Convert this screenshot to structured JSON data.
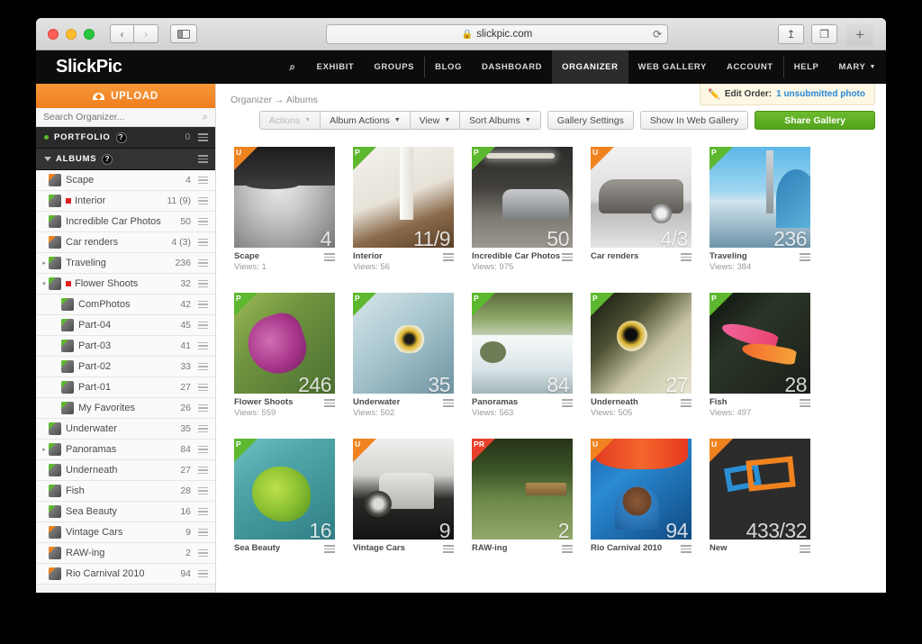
{
  "browser": {
    "url": "slickpic.com",
    "lock_icon": "lock-icon",
    "back_label": "‹",
    "forward_label": "›",
    "reload_label": "⟳",
    "share_label": "↥",
    "tabs_label": "❐",
    "newtab_label": "+"
  },
  "header": {
    "brand": "SlickPic",
    "nav": [
      {
        "label": "",
        "icon": "search-icon",
        "name": "nav-search",
        "active": false,
        "sep": false
      },
      {
        "label": "EXHIBIT",
        "name": "nav-exhibit",
        "active": false,
        "sep": false
      },
      {
        "label": "GROUPS",
        "name": "nav-groups",
        "active": false,
        "sep": false
      },
      {
        "label": "BLOG",
        "name": "nav-blog",
        "active": false,
        "sep": true
      },
      {
        "label": "DASHBOARD",
        "name": "nav-dashboard",
        "active": false,
        "sep": false
      },
      {
        "label": "ORGANIZER",
        "name": "nav-organizer",
        "active": true,
        "sep": false
      },
      {
        "label": "WEB GALLERY",
        "name": "nav-web-gallery",
        "active": false,
        "sep": false
      },
      {
        "label": "ACCOUNT",
        "name": "nav-account",
        "active": false,
        "sep": false
      },
      {
        "label": "HELP",
        "name": "nav-help",
        "active": false,
        "sep": true
      },
      {
        "label": "MARY",
        "name": "nav-user-menu",
        "active": false,
        "sep": false,
        "caret": true
      }
    ]
  },
  "sidebar": {
    "upload_label": "UPLOAD",
    "search_placeholder": "Search Organizer...",
    "portfolio": {
      "label": "PORTFOLIO",
      "help": "?",
      "count": "0"
    },
    "albums_header": {
      "label": "ALBUMS",
      "help": "?"
    },
    "items": [
      {
        "label": "Scape",
        "count": "4",
        "indent": 0,
        "expand": "",
        "corner": "orange",
        "flag": false
      },
      {
        "label": "Interior",
        "count": "11 (9)",
        "indent": 0,
        "expand": "",
        "corner": "green",
        "flag": true
      },
      {
        "label": "Incredible Car Photos",
        "count": "50",
        "indent": 0,
        "expand": "",
        "corner": "green",
        "flag": false
      },
      {
        "label": "Car renders",
        "count": "4 (3)",
        "indent": 0,
        "expand": "",
        "corner": "orange",
        "flag": false
      },
      {
        "label": "Traveling",
        "count": "236",
        "indent": 0,
        "expand": "▸",
        "corner": "green",
        "flag": false
      },
      {
        "label": "Flower Shoots",
        "count": "32",
        "indent": 0,
        "expand": "▾",
        "corner": "green",
        "flag": true
      },
      {
        "label": "ComPhotos",
        "count": "42",
        "indent": 1,
        "expand": "",
        "corner": "green",
        "flag": false
      },
      {
        "label": "Part-04",
        "count": "45",
        "indent": 1,
        "expand": "",
        "corner": "green",
        "flag": false
      },
      {
        "label": "Part-03",
        "count": "41",
        "indent": 1,
        "expand": "",
        "corner": "green",
        "flag": false
      },
      {
        "label": "Part-02",
        "count": "33",
        "indent": 1,
        "expand": "",
        "corner": "green",
        "flag": false
      },
      {
        "label": "Part-01",
        "count": "27",
        "indent": 1,
        "expand": "",
        "corner": "green",
        "flag": false
      },
      {
        "label": "My Favorites",
        "count": "26",
        "indent": 1,
        "expand": "",
        "corner": "green",
        "flag": false
      },
      {
        "label": "Underwater",
        "count": "35",
        "indent": 0,
        "expand": "",
        "corner": "green",
        "flag": false
      },
      {
        "label": "Panoramas",
        "count": "84",
        "indent": 0,
        "expand": "▸",
        "corner": "green",
        "flag": false
      },
      {
        "label": "Underneath",
        "count": "27",
        "indent": 0,
        "expand": "",
        "corner": "green",
        "flag": false
      },
      {
        "label": "Fish",
        "count": "28",
        "indent": 0,
        "expand": "",
        "corner": "green",
        "flag": false
      },
      {
        "label": "Sea Beauty",
        "count": "16",
        "indent": 0,
        "expand": "",
        "corner": "green",
        "flag": false
      },
      {
        "label": "Vintage Cars",
        "count": "9",
        "indent": 0,
        "expand": "",
        "corner": "orange",
        "flag": false
      },
      {
        "label": "RAW-ing",
        "count": "2",
        "indent": 0,
        "expand": "",
        "corner": "orange",
        "flag": false
      },
      {
        "label": "Rio Carnival 2010",
        "count": "94",
        "indent": 0,
        "expand": "",
        "corner": "orange",
        "flag": false
      }
    ]
  },
  "main": {
    "breadcrumb": "Organizer  →  Albums",
    "notice": {
      "prefix": "Edit Order:",
      "link": "1 unsubmitted photo",
      "icon": "pencil-icon"
    },
    "toolbar": {
      "actions": "Actions",
      "album_actions": "Album Actions",
      "view": "View",
      "sort_albums": "Sort Albums",
      "gallery_settings": "Gallery Settings",
      "show_in_web_gallery": "Show In Web Gallery",
      "share_gallery": "Share Gallery"
    },
    "albums": [
      {
        "name": "Scape",
        "views": "Views: 1",
        "count": "4",
        "badge": "U",
        "badge_type": "u",
        "art": "a-scape"
      },
      {
        "name": "Interior",
        "views": "Views: 56",
        "count": "11/9",
        "badge": "P",
        "badge_type": "p",
        "art": "a-interior"
      },
      {
        "name": "Incredible Car Photos",
        "views": "Views: 975",
        "count": "50",
        "badge": "P",
        "badge_type": "p",
        "art": "a-garage"
      },
      {
        "name": "Car renders",
        "views": "",
        "count": "4/3",
        "badge": "U",
        "badge_type": "u",
        "art": "a-carrender"
      },
      {
        "name": "Traveling",
        "views": "Views: 384",
        "count": "236",
        "badge": "P",
        "badge_type": "p",
        "art": "a-travel"
      },
      {
        "name": "Flower Shoots",
        "views": "Views: 559",
        "count": "246",
        "badge": "P",
        "badge_type": "p",
        "art": "a-flower"
      },
      {
        "name": "Underwater",
        "views": "Views: 502",
        "count": "35",
        "badge": "P",
        "badge_type": "p",
        "art": "a-under1"
      },
      {
        "name": "Panoramas",
        "views": "Views: 563",
        "count": "84",
        "badge": "P",
        "badge_type": "p",
        "art": "a-pano"
      },
      {
        "name": "Underneath",
        "views": "Views: 505",
        "count": "27",
        "badge": "P",
        "badge_type": "p",
        "art": "a-under2"
      },
      {
        "name": "Fish",
        "views": "Views: 497",
        "count": "28",
        "badge": "P",
        "badge_type": "p",
        "art": "a-fish"
      },
      {
        "name": "Sea Beauty",
        "views": "",
        "count": "16",
        "badge": "P",
        "badge_type": "p",
        "art": "a-sea"
      },
      {
        "name": "Vintage Cars",
        "views": "",
        "count": "9",
        "badge": "U",
        "badge_type": "u",
        "art": "a-vintage"
      },
      {
        "name": "RAW-ing",
        "views": "",
        "count": "2",
        "badge": "PR",
        "badge_type": "pr",
        "art": "a-raw"
      },
      {
        "name": "Rio Carnival 2010",
        "views": "",
        "count": "94",
        "badge": "U",
        "badge_type": "u",
        "art": "a-rio"
      },
      {
        "name": "New",
        "views": "",
        "count": "433/32",
        "badge": "U",
        "badge_type": "u",
        "art": "a-new"
      }
    ]
  },
  "colors": {
    "accent_orange": "#f0821f",
    "accent_green": "#5eb82f",
    "share_green": "#53a31c",
    "badge_red": "#e8402a",
    "topbar": "#0c0c0c",
    "link_blue": "#2a86d6"
  }
}
